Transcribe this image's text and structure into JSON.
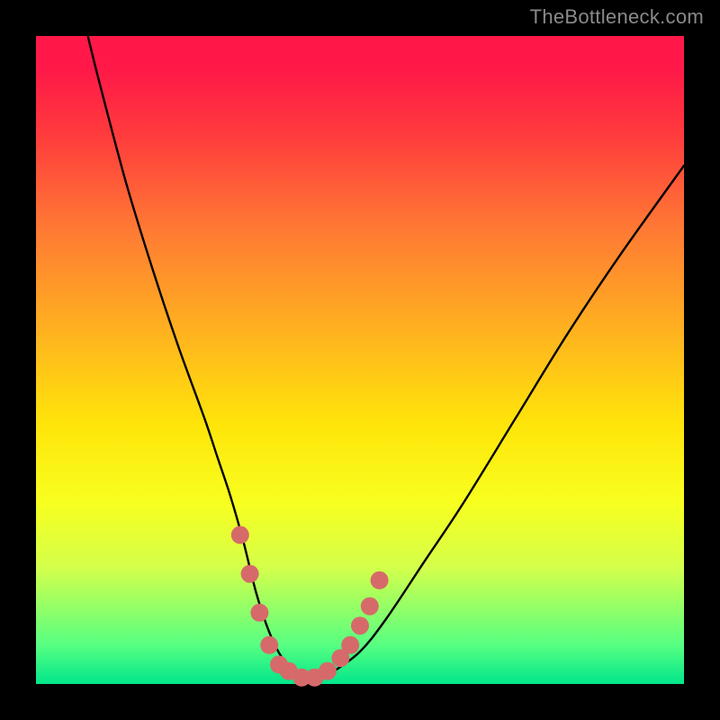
{
  "watermark": "TheBottleneck.com",
  "colors": {
    "background": "#000000",
    "curve": "#000000",
    "marker_fill": "#d66a6a",
    "marker_stroke": "#c45b5b",
    "gradient_stops": [
      {
        "offset": 0,
        "color": "#ff1848"
      },
      {
        "offset": 5,
        "color": "#ff1848"
      },
      {
        "offset": 15,
        "color": "#ff3a3d"
      },
      {
        "offset": 30,
        "color": "#ff7a34"
      },
      {
        "offset": 45,
        "color": "#ffb020"
      },
      {
        "offset": 60,
        "color": "#ffe50a"
      },
      {
        "offset": 72,
        "color": "#f7ff1f"
      },
      {
        "offset": 82,
        "color": "#d4ff4a"
      },
      {
        "offset": 94,
        "color": "#57ff82"
      },
      {
        "offset": 100,
        "color": "#00e68a"
      }
    ]
  },
  "chart_data": {
    "type": "line",
    "title": "",
    "xlabel": "",
    "ylabel": "",
    "xlim": [
      0,
      100
    ],
    "ylim": [
      0,
      100
    ],
    "series": [
      {
        "name": "bottleneck-curve",
        "x": [
          8,
          10,
          14,
          18,
          22,
          26,
          28,
          30,
          32,
          34,
          36,
          38,
          40,
          42,
          44,
          46,
          50,
          54,
          60,
          66,
          74,
          82,
          90,
          100
        ],
        "y": [
          100,
          92,
          77,
          64,
          52,
          41,
          35,
          29,
          22,
          14,
          8,
          4,
          2,
          1,
          1,
          2,
          5,
          10,
          19,
          28,
          41,
          54,
          66,
          80
        ]
      }
    ],
    "markers": {
      "name": "near-minimum-cluster",
      "points": [
        {
          "x": 31.5,
          "y": 23
        },
        {
          "x": 33,
          "y": 17
        },
        {
          "x": 34.5,
          "y": 11
        },
        {
          "x": 36,
          "y": 6
        },
        {
          "x": 37.5,
          "y": 3
        },
        {
          "x": 39,
          "y": 2
        },
        {
          "x": 41,
          "y": 1
        },
        {
          "x": 43,
          "y": 1
        },
        {
          "x": 45,
          "y": 2
        },
        {
          "x": 47,
          "y": 4
        },
        {
          "x": 48.5,
          "y": 6
        },
        {
          "x": 50,
          "y": 9
        },
        {
          "x": 51.5,
          "y": 12
        },
        {
          "x": 53,
          "y": 16
        }
      ]
    }
  }
}
